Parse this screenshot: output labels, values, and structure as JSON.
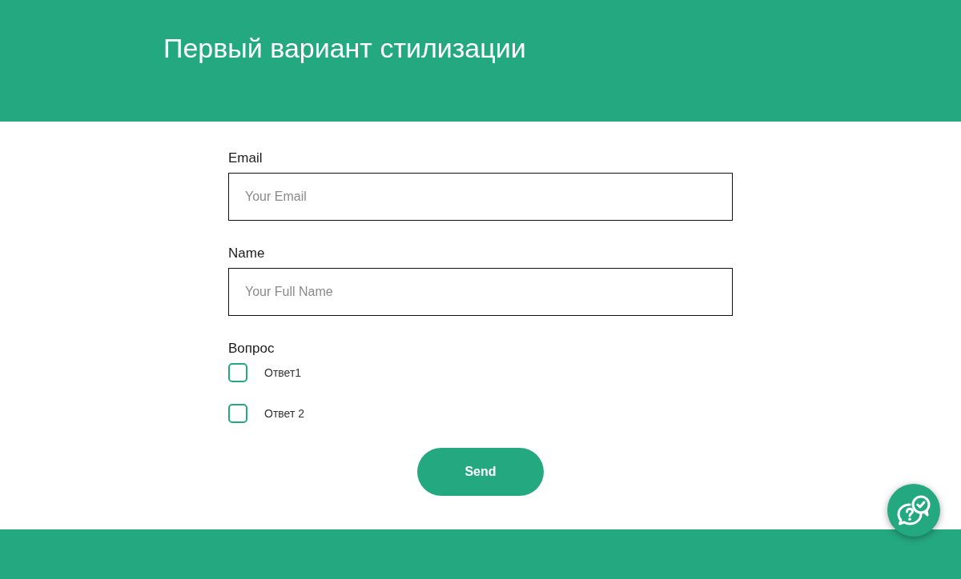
{
  "header": {
    "title": "Первый вариант стилизации"
  },
  "form": {
    "fields": [
      {
        "label": "Email",
        "placeholder": "Your Email"
      },
      {
        "label": "Name",
        "placeholder": "Your Full Name"
      }
    ],
    "question": {
      "label": "Вопрос",
      "options": [
        {
          "label": "Ответ1",
          "checked": false
        },
        {
          "label": "Ответ 2",
          "checked": false
        }
      ]
    },
    "submit": {
      "label": "Send"
    }
  }
}
